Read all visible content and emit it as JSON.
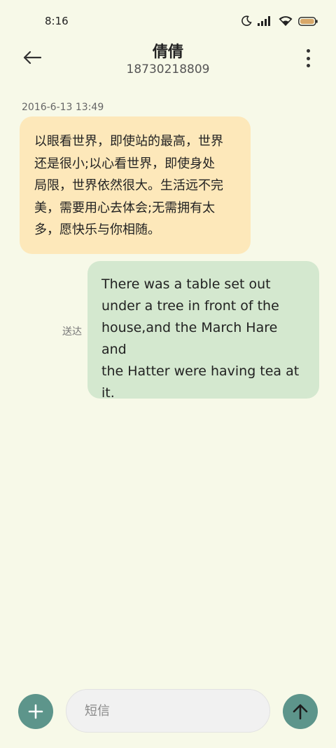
{
  "status_bar": {
    "time": "8:16",
    "icons": [
      "moon-icon",
      "signal-icon",
      "wifi-icon",
      "battery-icon"
    ]
  },
  "header": {
    "contact_name": "倩倩",
    "contact_number": "18730218809",
    "back_icon": "arrow-left-icon",
    "more_icon": "more-vertical-icon"
  },
  "conversation": {
    "timestamp": "2016-6-13 13:49",
    "messages": [
      {
        "direction": "incoming",
        "lines": [
          "以眼看世界，即使站的最高，世界",
          "还是很小;以心看世界，即使身处",
          "局限，世界依然很大。生活远不完",
          "美，需要用心去体会;无需拥有太",
          "多，愿快乐与你相随。"
        ]
      },
      {
        "direction": "outgoing",
        "status": "送达",
        "lines": [
          "There was a table set out",
          "under a tree in front of the",
          "house,and the March Hare and",
          "the Hatter were having tea at",
          "it."
        ]
      }
    ]
  },
  "composer": {
    "placeholder": "短信",
    "value": "",
    "add_icon": "plus-icon",
    "send_icon": "arrow-up-icon"
  },
  "colors": {
    "background": "#f7f9e8",
    "incoming_bubble": "#fde8ba",
    "outgoing_bubble": "#d4e8cf",
    "accent": "#5d958b"
  }
}
